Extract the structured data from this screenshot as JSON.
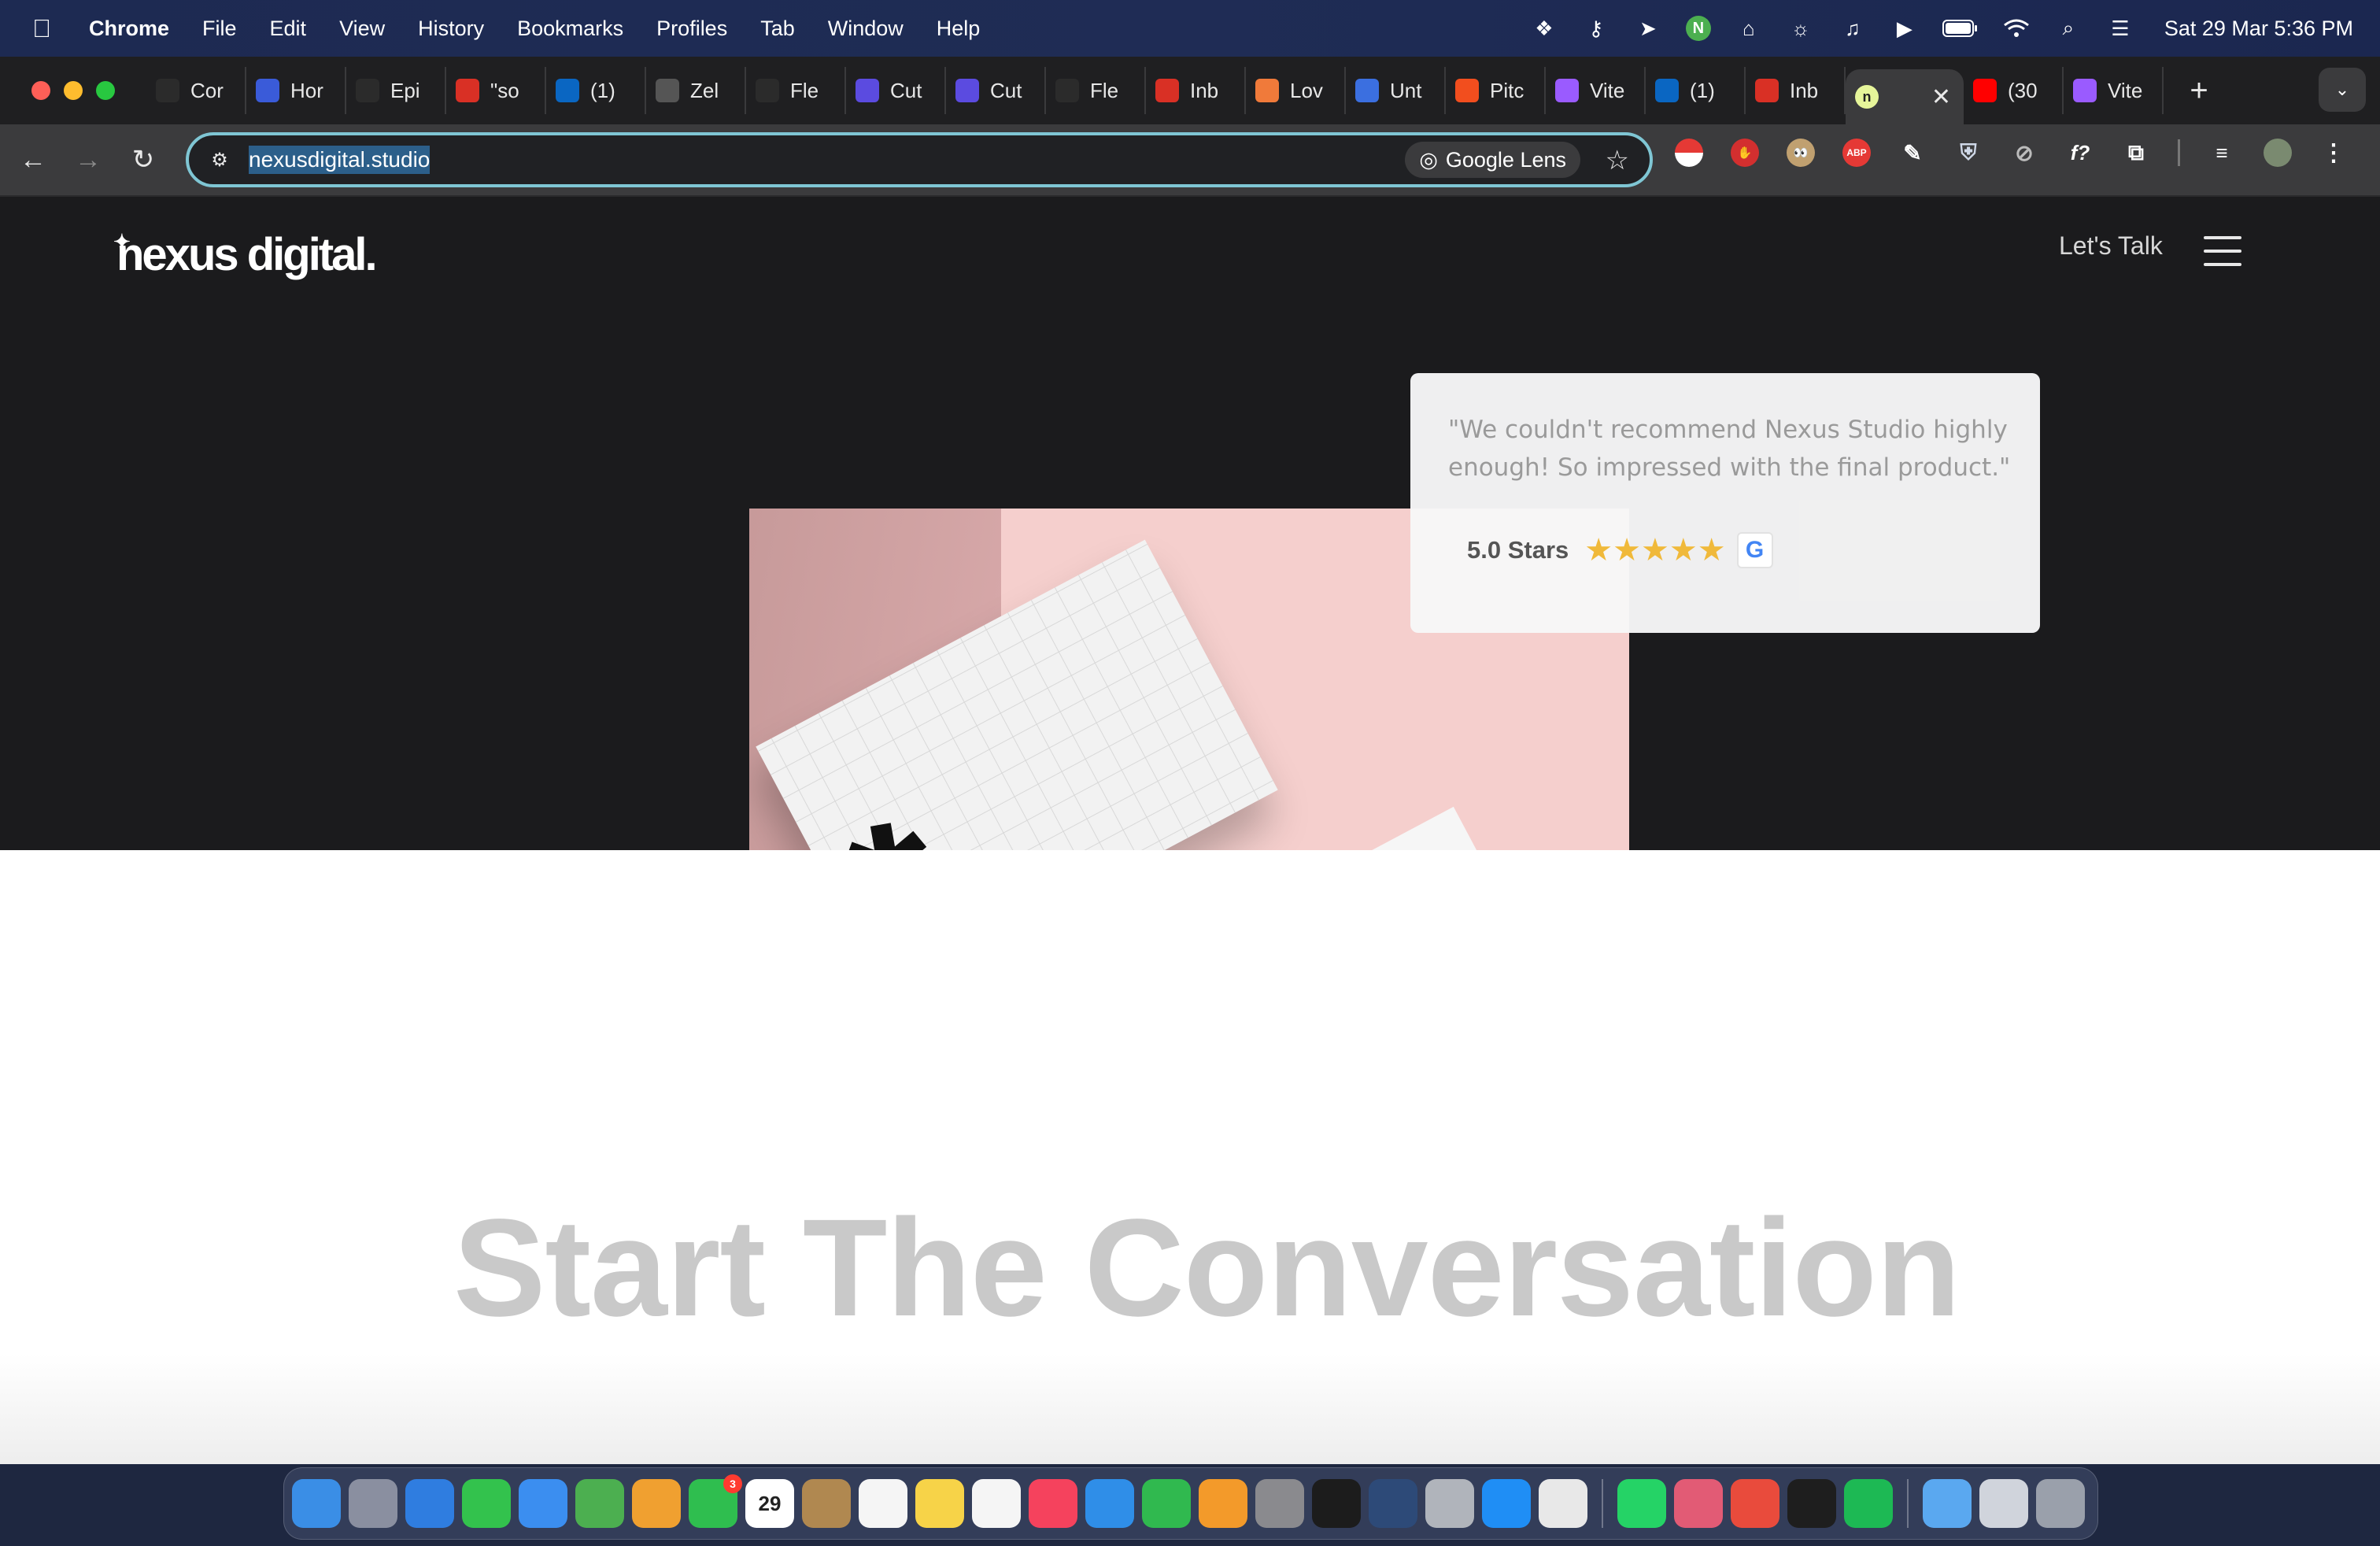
{
  "menubar": {
    "app_name": "Chrome",
    "menus": [
      "File",
      "Edit",
      "View",
      "History",
      "Bookmarks",
      "Profiles",
      "Tab",
      "Window",
      "Help"
    ],
    "clock": "Sat 29 Mar  5:36 PM",
    "status_icons": [
      "figma-icon",
      "key-icon",
      "cursor-icon",
      "n-avatar-icon",
      "hotspot-icon",
      "brightness-icon",
      "airpods-icon",
      "play-icon",
      "battery-icon",
      "wifi-icon",
      "search-icon",
      "control-center-icon"
    ]
  },
  "tabs": [
    {
      "label": "Cor",
      "icon": "openai-icon",
      "color": "#2b2b2b"
    },
    {
      "label": "Hor",
      "icon": "k-icon",
      "color": "#3a5bd9"
    },
    {
      "label": "Epi",
      "icon": "dots-icon",
      "color": "#2b2b2b"
    },
    {
      "label": "\"so",
      "icon": "gmail-icon",
      "color": "#d93025"
    },
    {
      "label": "(1)",
      "icon": "linkedin-icon",
      "color": "#0a66c2"
    },
    {
      "label": "Zel",
      "icon": "pen-icon",
      "color": "#555555"
    },
    {
      "label": "Fle",
      "icon": "fx-icon",
      "color": "#2b2b2b"
    },
    {
      "label": "Cut",
      "icon": "c-icon",
      "color": "#5b4be0"
    },
    {
      "label": "Cut",
      "icon": "c-icon",
      "color": "#5b4be0"
    },
    {
      "label": "Fle",
      "icon": "fx-icon",
      "color": "#2b2b2b"
    },
    {
      "label": "Inb",
      "icon": "gmail-icon",
      "color": "#d93025"
    },
    {
      "label": "Lov",
      "icon": "heart-icon",
      "color": "#f07a3a"
    },
    {
      "label": "Unt",
      "icon": "docs-icon",
      "color": "#3b6fe0"
    },
    {
      "label": "Pitc",
      "icon": "figma-icon",
      "color": "#f24e1e"
    },
    {
      "label": "Vite",
      "icon": "vite-icon",
      "color": "#9a5bff"
    },
    {
      "label": "(1)",
      "icon": "linkedin-icon",
      "color": "#0a66c2"
    },
    {
      "label": "Inb",
      "icon": "gmail-icon",
      "color": "#d93025"
    }
  ],
  "active_tab": {
    "icon": "n-icon",
    "close": "✕"
  },
  "tabs_after": [
    {
      "label": "(30",
      "icon": "youtube-icon",
      "color": "#ff0000"
    },
    {
      "label": "Vite",
      "icon": "vite-icon",
      "color": "#9a5bff"
    }
  ],
  "toolbar": {
    "url": "nexusdigital.studio",
    "lens_label": "Google Lens"
  },
  "extensions": [
    "pokeball-icon",
    "hand-icon",
    "eyes-icon",
    "abp-icon",
    "eyedropper-icon",
    "shield-icon",
    "compass-icon",
    "fx-icon",
    "puzzle-icon"
  ],
  "site": {
    "logo": "nexus digital.",
    "nav_cta": "Let's Talk",
    "review_quote": "\"We couldn't recommend Nexus Studio highly enough! So impressed with the final product.\"",
    "rating_label": "5.0 Stars",
    "stars": "★★★★★",
    "google_badge": "G",
    "cta_heading": "Start The Conversation"
  },
  "dock": [
    {
      "name": "finder-icon",
      "color": "#3a8ee6"
    },
    {
      "name": "launchpad-icon",
      "color": "#8a8fa0"
    },
    {
      "name": "safari-icon",
      "color": "#2f7de0"
    },
    {
      "name": "messages-icon",
      "color": "#33c24d"
    },
    {
      "name": "mail-icon",
      "color": "#3b8ef0"
    },
    {
      "name": "maps-icon",
      "color": "#4caf50"
    },
    {
      "name": "photos-icon",
      "color": "#f0a030"
    },
    {
      "name": "facetime-icon",
      "color": "#2fbe4f",
      "badge": "3"
    },
    {
      "name": "calendar-icon",
      "color": "#ffffff",
      "text": "29"
    },
    {
      "name": "contacts-icon",
      "color": "#b08850"
    },
    {
      "name": "reminders-icon",
      "color": "#f5f5f5"
    },
    {
      "name": "notes-icon",
      "color": "#f7d348"
    },
    {
      "name": "freeform-icon",
      "color": "#f5f5f5"
    },
    {
      "name": "music-icon",
      "color": "#f5425d"
    },
    {
      "name": "keynote-icon",
      "color": "#2f8ee8"
    },
    {
      "name": "numbers-icon",
      "color": "#30b94f"
    },
    {
      "name": "pages-icon",
      "color": "#f39a2a"
    },
    {
      "name": "settings-icon",
      "color": "#8a8a8e"
    },
    {
      "name": "terminal-icon",
      "color": "#1c1c1c"
    },
    {
      "name": "mysql-icon",
      "color": "#2d4a78"
    },
    {
      "name": "notebook-icon",
      "color": "#b0b4bb"
    },
    {
      "name": "appstore-icon",
      "color": "#1f8ef5"
    },
    {
      "name": "chrome-icon",
      "color": "#e8e8e8"
    },
    {
      "name": "whatsapp-icon",
      "color": "#25d366"
    },
    {
      "name": "linear-icon",
      "color": "#e25b75"
    },
    {
      "name": "screens-icon",
      "color": "#e94b3c"
    },
    {
      "name": "figma-icon",
      "color": "#1e1e1e"
    },
    {
      "name": "spotify-icon",
      "color": "#1db954"
    },
    {
      "name": "folder-icon",
      "color": "#5aa8f0"
    },
    {
      "name": "screen-icon",
      "color": "#d0d4dc"
    },
    {
      "name": "trash-icon",
      "color": "#9aa0ab"
    }
  ]
}
